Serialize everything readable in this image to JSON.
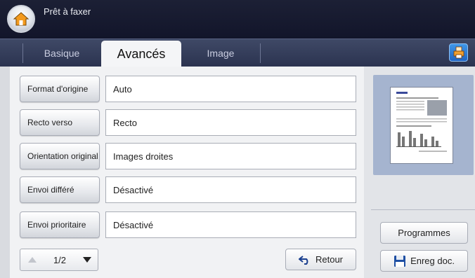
{
  "header": {
    "title": "Prêt à faxer",
    "home_icon": "home-icon"
  },
  "tabs": [
    {
      "label": "Basique",
      "active": false
    },
    {
      "label": "Avancés",
      "active": true
    },
    {
      "label": "Image",
      "active": false
    }
  ],
  "options": [
    {
      "button": "Format d'origine",
      "value": "Auto"
    },
    {
      "button": "Recto verso",
      "value": "Recto"
    },
    {
      "button": "Orientation original",
      "value": "Images droites"
    },
    {
      "button": "Envoi différé",
      "value": "Désactivé"
    },
    {
      "button": "Envoi prioritaire",
      "value": "Désactivé"
    }
  ],
  "pager": {
    "label": "1/2",
    "up_icon": "triangle-up-icon",
    "down_icon": "triangle-down-icon"
  },
  "buttons": {
    "back": "Retour",
    "programs": "Programmes",
    "save_doc": "Enreg doc."
  },
  "colors": {
    "titlebar": "#12152a",
    "tabbar": "#2f3855",
    "accent_button": "#2a7ad6",
    "preview_bg": "#a5b4cf"
  }
}
